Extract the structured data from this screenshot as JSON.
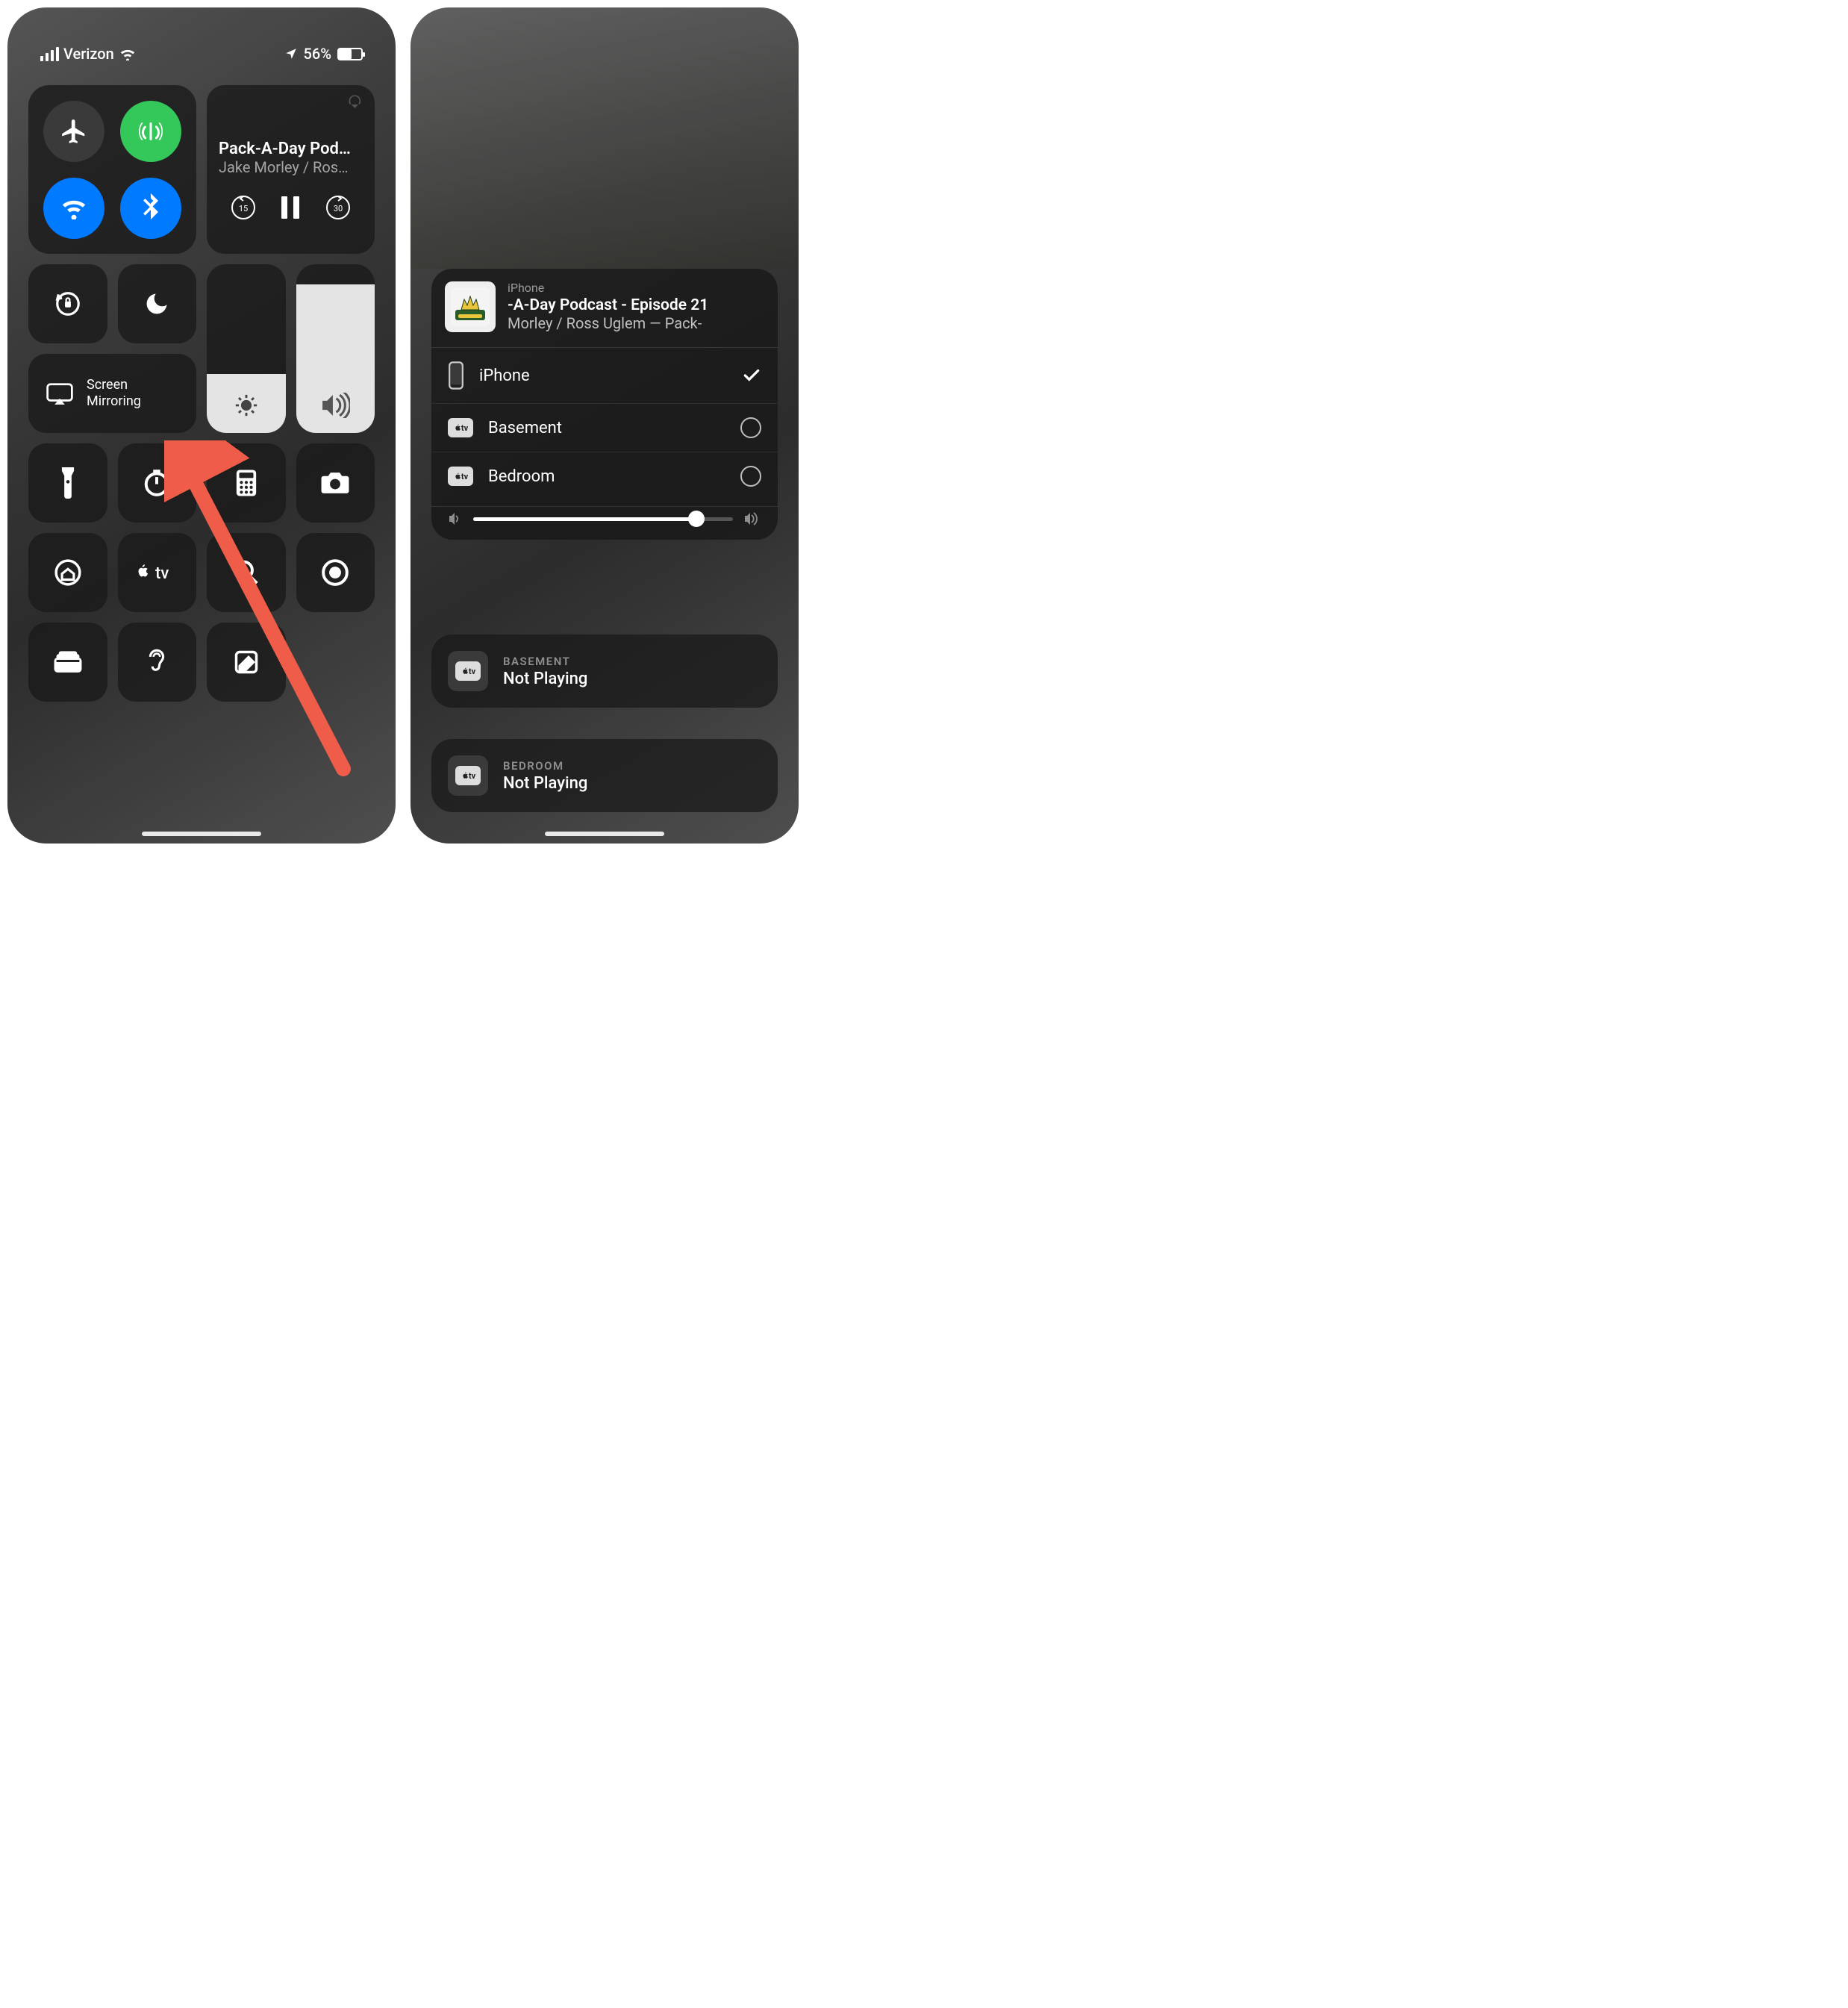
{
  "status": {
    "carrier": "Verizon",
    "battery_pct": "56%"
  },
  "media": {
    "title": "Pack-A-Day Pod…",
    "subtitle": "Jake Morley / Ros…",
    "back_sec": "15",
    "fwd_sec": "30"
  },
  "screen_mirroring_label": "Screen\nMirroring",
  "airplay": {
    "device_label": "iPhone",
    "title": "-A-Day Podcast - Episode 21",
    "subtitle": "Morley / Ross Uglem — Pack-",
    "rows": [
      {
        "name": "iPhone",
        "type": "phone",
        "selected": true
      },
      {
        "name": "Basement",
        "type": "atv",
        "selected": false
      },
      {
        "name": "Bedroom",
        "type": "atv",
        "selected": false
      }
    ],
    "volume": 0.86
  },
  "other_sources": [
    {
      "room": "BASEMENT",
      "status": "Not Playing"
    },
    {
      "room": "BEDROOM",
      "status": "Not Playing"
    }
  ]
}
